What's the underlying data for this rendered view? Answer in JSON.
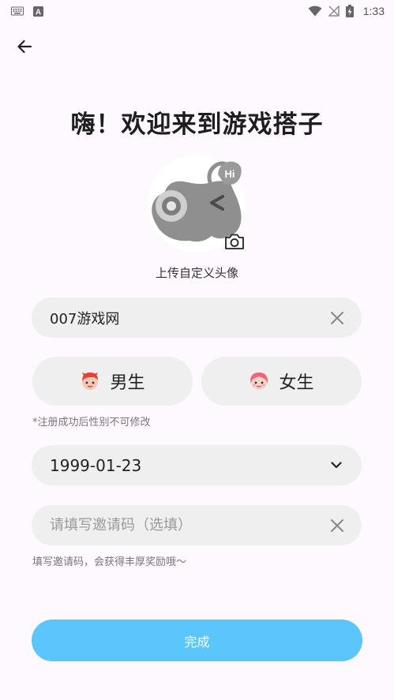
{
  "status_bar": {
    "time": "1:33",
    "icons": [
      "keyboard-icon",
      "a-notification-icon",
      "wifi-icon",
      "no-signal-icon",
      "battery-charging-icon"
    ]
  },
  "header": {
    "back_icon": "arrow-left-icon"
  },
  "title": "嗨！欢迎来到游戏搭子",
  "avatar": {
    "hint": "上传自定义头像",
    "camera_icon": "camera-icon"
  },
  "nickname": {
    "value": "007游戏网",
    "clear_icon": "close-icon"
  },
  "gender": {
    "male_label": "男生",
    "female_label": "女生",
    "note": "*注册成功后性别不可修改"
  },
  "birthday": {
    "value": "1999-01-23",
    "dropdown_icon": "chevron-down-icon"
  },
  "invite": {
    "placeholder": "请填写邀请码（选填）",
    "clear_icon": "close-icon",
    "note": "填写邀请码，会获得丰厚奖励哦～"
  },
  "submit": {
    "label": "完成"
  },
  "colors": {
    "accent": "#5bc6fb",
    "pill_bg": "#efefef",
    "background": "#fdf9ff"
  }
}
